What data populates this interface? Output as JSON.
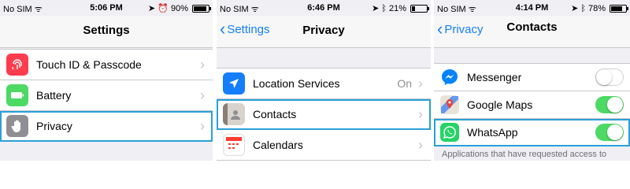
{
  "screen1": {
    "status": {
      "carrier": "No SIM",
      "time": "5:06 PM",
      "battery": "90%",
      "battery_level": 0.9
    },
    "nav_title": "Settings",
    "rows": [
      {
        "label": "Touch ID & Passcode",
        "icon": "fingerprint-icon",
        "color": "#ff3b4e"
      },
      {
        "label": "Battery",
        "icon": "battery-icon",
        "color": "#4cd964"
      },
      {
        "label": "Privacy",
        "icon": "hand-icon",
        "color": "#8e8e93"
      }
    ]
  },
  "screen2": {
    "status": {
      "carrier": "No SIM",
      "time": "6:46 PM",
      "battery": "21%",
      "battery_level": 0.21
    },
    "back_label": "Settings",
    "nav_title": "Privacy",
    "rows": [
      {
        "label": "Location Services",
        "value": "On",
        "icon": "location-arrow-icon",
        "color": "#147efb"
      },
      {
        "label": "Contacts",
        "icon": "contacts-icon",
        "color": "#a8a29b"
      },
      {
        "label": "Calendars",
        "icon": "calendar-icon",
        "color": "#ffffff"
      }
    ]
  },
  "screen3": {
    "status": {
      "carrier": "No SIM",
      "time": "4:14 PM",
      "battery": "78%",
      "battery_level": 0.78
    },
    "back_label": "Privacy",
    "nav_title": "Contacts",
    "rows": [
      {
        "label": "Messenger",
        "toggle": "off",
        "icon": "messenger-icon",
        "color": "#0084ff"
      },
      {
        "label": "Google Maps",
        "toggle": "on",
        "icon": "google-maps-icon",
        "color": "#34a853"
      },
      {
        "label": "WhatsApp",
        "toggle": "on",
        "icon": "whatsapp-icon",
        "color": "#25d366"
      }
    ],
    "footer": "Applications that have requested access to"
  },
  "colors": {
    "highlight": "#2ba0d8",
    "toggle_on": "#4cd964",
    "link": "#147efb"
  }
}
